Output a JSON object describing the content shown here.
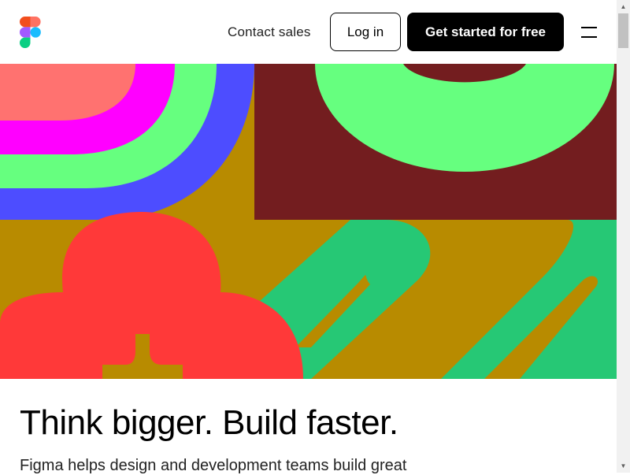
{
  "header": {
    "logo": "figma-logo",
    "contact_label": "Contact sales",
    "login_label": "Log in",
    "cta_label": "Get started for free",
    "menu_icon": "hamburger-menu-icon"
  },
  "hero": {
    "illustration": "abstract-shapes-artwork",
    "colors": {
      "mustard": "#b88b00",
      "maroon": "#731d1f",
      "green": "#66ff7f",
      "salmon": "#ff7270",
      "magenta": "#ff00ff",
      "blue": "#4d4dff",
      "red": "#ff3939",
      "teal": "#26c875"
    }
  },
  "main": {
    "headline": "Think bigger. Build faster.",
    "subcopy": "Figma helps design and development teams build great"
  },
  "scrollbar": {
    "up_icon": "scroll-up-icon",
    "down_icon": "scroll-down-icon"
  }
}
